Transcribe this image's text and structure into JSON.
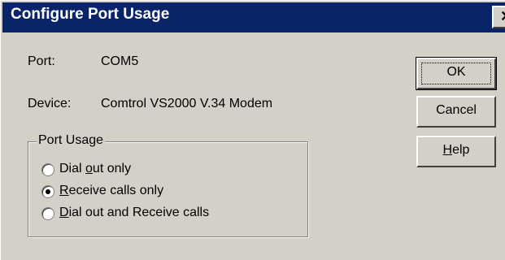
{
  "window": {
    "title": "Configure Port Usage",
    "close_glyph": "✕"
  },
  "info": {
    "port_label": "Port:",
    "port_value": "COM5",
    "device_label": "Device:",
    "device_value": "Comtrol VS2000 V.34 Modem"
  },
  "port_usage": {
    "legend": "Port Usage",
    "options": [
      {
        "pre": "Dial ",
        "accel": "o",
        "post": "ut only",
        "selected": false
      },
      {
        "pre": "",
        "accel": "R",
        "post": "eceive calls only",
        "selected": true
      },
      {
        "pre": "",
        "accel": "D",
        "post": "ial out and Receive calls",
        "selected": false
      }
    ]
  },
  "buttons": {
    "ok": "OK",
    "cancel": "Cancel",
    "help_accel": "H",
    "help_rest": "elp"
  }
}
